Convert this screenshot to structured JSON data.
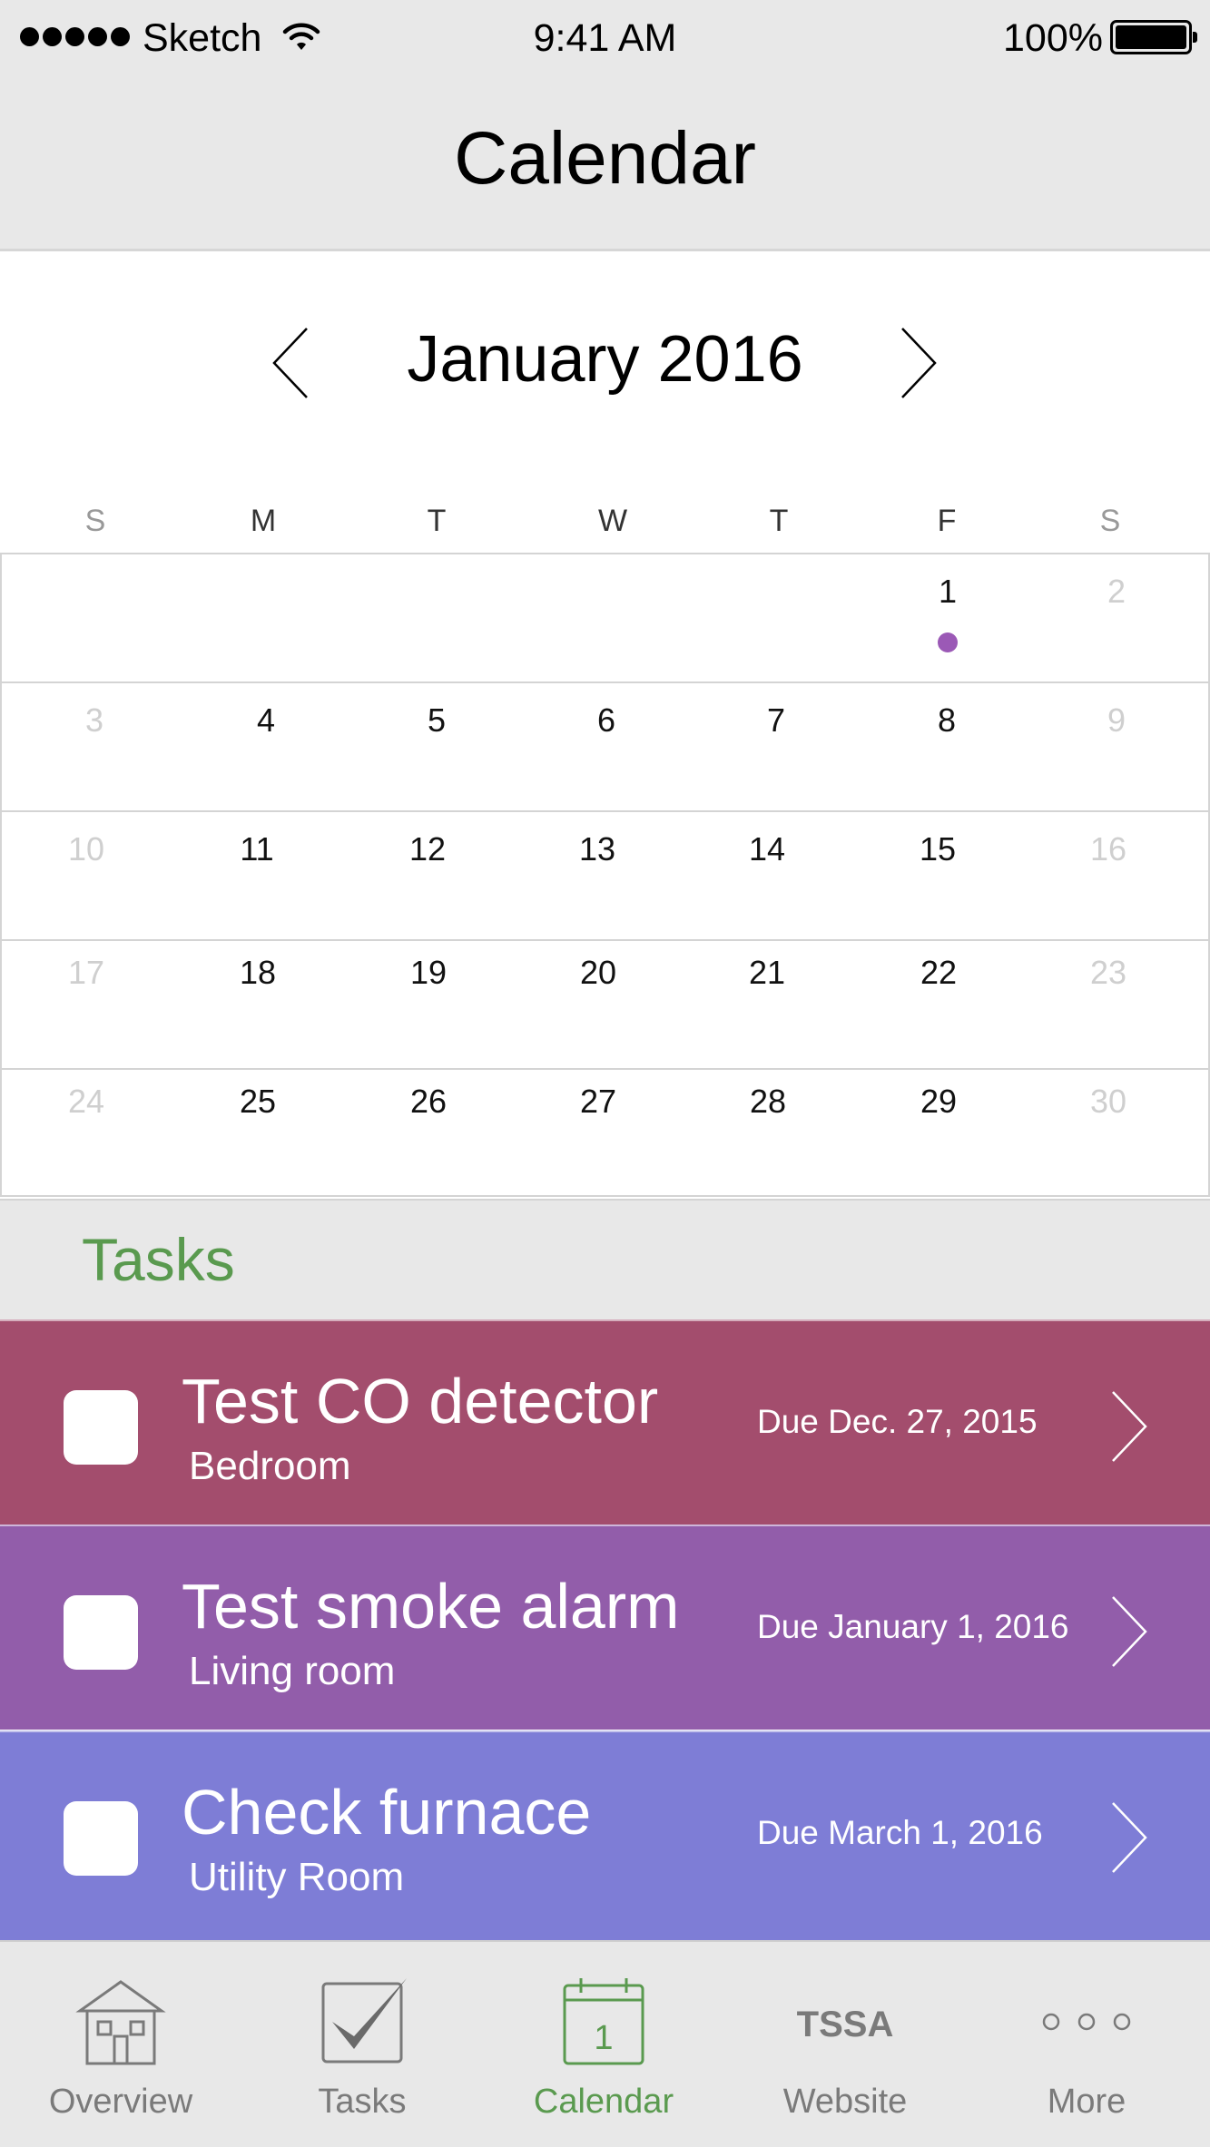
{
  "status_bar": {
    "carrier": "Sketch",
    "time": "9:41 AM",
    "battery": "100%"
  },
  "nav": {
    "title": "Calendar"
  },
  "calendar": {
    "month": "January 2016",
    "weekdays": [
      "S",
      "M",
      "T",
      "W",
      "T",
      "F",
      "S"
    ],
    "weeks": [
      [
        "",
        "",
        "",
        "",
        "",
        "1",
        "2"
      ],
      [
        "3",
        "4",
        "5",
        "6",
        "7",
        "8",
        "9"
      ],
      [
        "10",
        "11",
        "12",
        "13",
        "14",
        "15",
        "16"
      ],
      [
        "17",
        "18",
        "19",
        "20",
        "21",
        "22",
        "23"
      ],
      [
        "24",
        "25",
        "26",
        "27",
        "28",
        "29",
        "30"
      ]
    ],
    "event_day": "1",
    "event_color": "#9b59b6"
  },
  "tasks": {
    "heading": "Tasks",
    "items": [
      {
        "title": "Test CO detector",
        "room": "Bedroom",
        "due": "Due Dec. 27, 2015",
        "color": "#a34d6d"
      },
      {
        "title": "Test smoke alarm",
        "room": "Living room",
        "due": "Due January 1, 2016",
        "color": "#925daa"
      },
      {
        "title": "Check furnace",
        "room": "Utility Room",
        "due": "Due March 1, 2016",
        "color": "#7e7dd6"
      }
    ]
  },
  "tabbar": {
    "items": [
      {
        "label": "Overview",
        "icon": "house-icon"
      },
      {
        "label": "Tasks",
        "icon": "checkmark-icon"
      },
      {
        "label": "Calendar",
        "icon": "calendar-icon",
        "badge": "1",
        "active": true
      },
      {
        "label": "Website",
        "icon": "tssa-logo-icon",
        "logo_text": "TSSA"
      },
      {
        "label": "More",
        "icon": "more-icon"
      }
    ],
    "active_color": "#5a9a4f",
    "inactive_color": "#7a7a7a"
  }
}
